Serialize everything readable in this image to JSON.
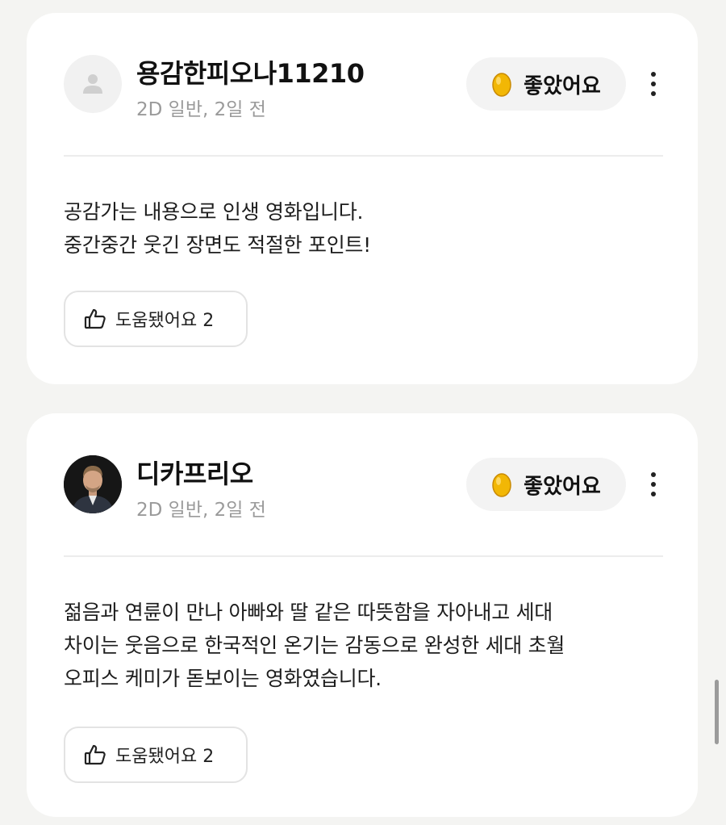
{
  "reviews": [
    {
      "username": "용감한피오나11210",
      "meta": "2D 일반, 2일 전",
      "rating_label": "좋았어요",
      "review_lines": [
        "공감가는 내용으로 인생 영화입니다.",
        "중간중간 웃긴 장면도 적절한 포인트!"
      ],
      "helpful_label": "도움됐어요 2",
      "avatar": "default-user-icon"
    },
    {
      "username": "디카프리오",
      "meta": "2D 일반, 2일 전",
      "rating_label": "좋았어요",
      "review_lines": [
        "젊음과 연륜이 만나 아빠와 딸 같은 따뜻함을 자아내고 세대",
        "차이는 웃음으로 한국적인 온기는 감동으로 완성한 세대 초월",
        "오피스 케미가 돋보이는 영화였습니다."
      ],
      "helpful_label": "도움됐어요 2",
      "avatar": "profile-photo"
    }
  ],
  "colors": {
    "background": "#f4f4f2",
    "card": "#ffffff",
    "egg": "#f2b705",
    "meta_text": "#9a9a9a"
  }
}
